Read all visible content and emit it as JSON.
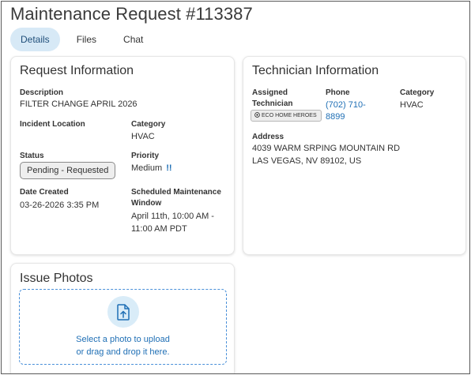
{
  "page": {
    "title": "Maintenance Request #113387"
  },
  "tabs": [
    {
      "label": "Details",
      "active": true
    },
    {
      "label": "Files",
      "active": false
    },
    {
      "label": "Chat",
      "active": false
    }
  ],
  "request_info": {
    "title": "Request Information",
    "description_label": "Description",
    "description_value": "FILTER CHANGE APRIL 2026",
    "location_label": "Incident Location",
    "location_value": "",
    "category_label": "Category",
    "category_value": "HVAC",
    "status_label": "Status",
    "status_value": "Pending - Requested",
    "priority_label": "Priority",
    "priority_value": "Medium",
    "priority_flag": "!!",
    "date_created_label": "Date Created",
    "date_created_value": "03-26-2026 3:35 PM",
    "scheduled_label_line1": "Scheduled Maintenance",
    "scheduled_label_line2": "Window",
    "scheduled_value_line1": "April 11th, 10:00 AM -",
    "scheduled_value_line2": "11:00 AM PDT"
  },
  "technician_info": {
    "title": "Technician Information",
    "assigned_label_line1": "Assigned",
    "assigned_label_line2": "Technician",
    "vendor_chip": "ECO HOME HEROES",
    "vendor_icon": "vendor-badge-icon",
    "phone_label": "Phone",
    "phone_line1": "(702) 710-",
    "phone_line2": "8899",
    "category_label": "Category",
    "category_value": "HVAC",
    "address_label": "Address",
    "address_line1": "4039 WARM SRPING MOUNTAIN RD",
    "address_line2": "LAS VEGAS, NV 89102, US"
  },
  "issue_photos": {
    "title": "Issue Photos",
    "upload_icon": "file-upload-icon",
    "upload_line1": "Select a photo to upload",
    "upload_line2": "or drag and drop it here."
  },
  "colors": {
    "accent": "#1f6fb5",
    "tab_active_bg": "#d7e9f6",
    "upload_border": "#4a90d9",
    "upload_circle": "#d9ecf8",
    "status_pill_bg": "#eeeeee"
  }
}
